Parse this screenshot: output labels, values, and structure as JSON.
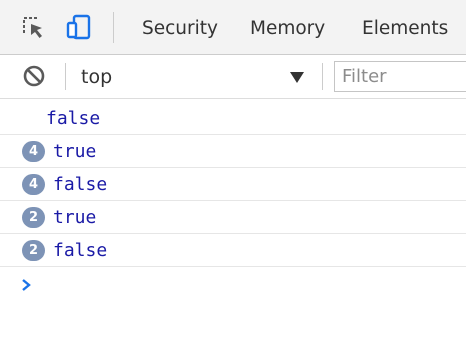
{
  "tabbar": {
    "icons": [
      "inspect-element-icon",
      "device-toolbar-icon"
    ],
    "tabs": [
      "Security",
      "Memory",
      "Elements"
    ]
  },
  "toolbar": {
    "clear_icon": "clear-console-icon",
    "context": "top",
    "filter_placeholder": "Filter"
  },
  "console": {
    "messages": [
      {
        "count": "",
        "text": "false"
      },
      {
        "count": "4",
        "text": "true"
      },
      {
        "count": "4",
        "text": "false"
      },
      {
        "count": "2",
        "text": "true"
      },
      {
        "count": "2",
        "text": "false"
      }
    ],
    "prompt_icon": "chevron-right-icon"
  },
  "colors": {
    "value_text": "#1a1aa6",
    "badge": "#7d93b6",
    "accent": "#1a73e8"
  }
}
